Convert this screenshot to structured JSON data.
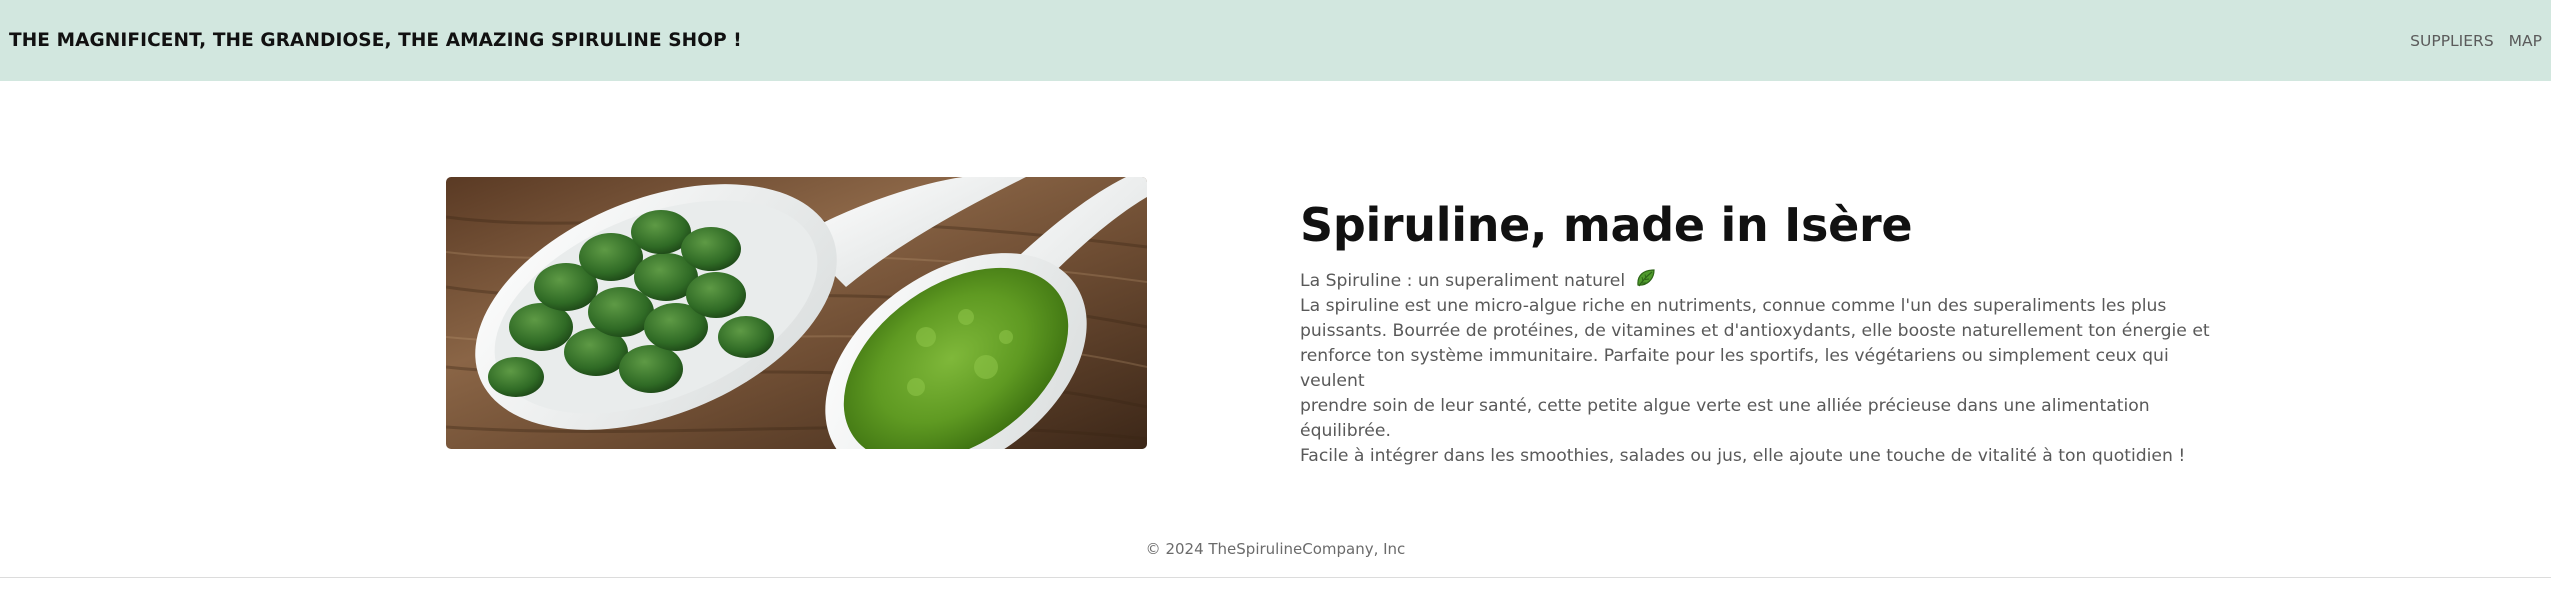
{
  "navbar": {
    "brand": "THE MAGNIFICENT, THE GRANDIOSE, THE AMAZING SPIRULINE SHOP !",
    "links": [
      {
        "label": "SUPPLIERS"
      },
      {
        "label": "MAP"
      }
    ],
    "background": "#d2e7df"
  },
  "hero": {
    "image_icon": "spirulina-photo",
    "title": "Spiruline, made in Isère",
    "intro": "La Spiruline : un superaliment naturel",
    "intro_icon": "leaf-icon",
    "lines": [
      "La spiruline est une micro-algue riche en nutriments, connue comme l'un des superaliments les plus",
      "puissants. Bourrée de protéines, de vitamines et d'antioxydants, elle booste naturellement ton énergie et",
      "renforce ton système immunitaire. Parfaite pour les sportifs, les végétariens ou simplement ceux qui veulent",
      "prendre soin de leur santé, cette petite algue verte est une alliée précieuse dans une alimentation équilibrée.",
      "Facile à intégrer dans les smoothies, salades ou jus, elle ajoute une touche de vitalité à ton quotidien !"
    ]
  },
  "footer": {
    "copyright": "© 2024 TheSpirulineCompany, Inc"
  }
}
